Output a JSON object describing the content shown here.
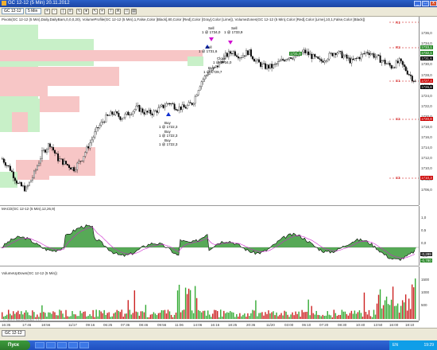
{
  "window": {
    "title": "GC 12-12 (5 Min)  20.11.2012",
    "minimize_label": "_",
    "maximize_label": "□",
    "close_label": "x"
  },
  "toolbar": {
    "instrument": "GC 12-12",
    "timeframe": "5 Min"
  },
  "price_pane": {
    "indicator_text": "Pivots(GC 12-12 (5 Min),Daily,DailyBars,0,0,0,20), VolumeProfile(GC 12-12 (5 Min),1,False,Color [Black],80,Color [Red],Color [Gray],Color [Lime]), VolumeZones(GC 12-12 (5 Min),Color [Red],Color [Lime],10,1,False,Color [Black])",
    "price_ticks": [
      "1736,0",
      "1734,0",
      "1732,0",
      "1730,0",
      "1728,0",
      "1726,0",
      "1724,0",
      "1722,0",
      "1720,0",
      "1718,0",
      "1716,0",
      "1714,0",
      "1712,0",
      "1710,0",
      "1708,0",
      "1706,0"
    ],
    "pivot_tags": [
      {
        "name": "R1",
        "value": ""
      },
      {
        "name": "R2",
        "value": "1733,1"
      },
      {
        "name": "S1",
        "value": "1727,4"
      },
      {
        "name": "S2",
        "value": "1720,8"
      },
      {
        "name": "S3",
        "value": "1710,3"
      }
    ],
    "current_price": "1731,6",
    "price_tags": [
      "1732,1",
      "1726,8"
    ],
    "mid_tag": "1731,8",
    "annotations": [
      {
        "text": "Sell"
      },
      {
        "text": "1 @ 1734,0"
      },
      {
        "text": "Sell"
      },
      {
        "text": "1 @ 1733,9"
      },
      {
        "text": "Sell"
      },
      {
        "text": "1 @ 1731,6"
      },
      {
        "text": "Close"
      },
      {
        "text": "1 @ 1734,0"
      },
      {
        "text": "Buy"
      },
      {
        "text": "1 @ 1729,7"
      },
      {
        "text": "Buy"
      },
      {
        "text": "1 @ 1722,3"
      },
      {
        "text": "Buy"
      },
      {
        "text": "1 @ 1722,3"
      },
      {
        "text": "Buy"
      },
      {
        "text": "1 @ 1722,3"
      }
    ]
  },
  "macd_pane": {
    "label": "MACD(GC 12-12 (5 Min),12,26,9)",
    "ticks": [
      "1,0",
      "0,5",
      "0,0",
      "-0,5"
    ],
    "tags": [
      "-0,289",
      "-0,780"
    ]
  },
  "volume_pane": {
    "label": "VolumeUpDown(GC 12-12 (5 Min))",
    "ticks": [
      "1500",
      "1000",
      "500"
    ]
  },
  "time_axis": [
    "16:35",
    "17:46",
    "18:56",
    "11/17",
    "09:16",
    "06:25",
    "07:36",
    "08:46",
    "09:56",
    "11:06",
    "14:06",
    "16:16",
    "18:25",
    "20:36",
    "11/20",
    "03:00",
    "06:10",
    "07:20",
    "08:30",
    "10:40",
    "13:50",
    "16:00",
    "18:10"
  ],
  "copyright": "© 2012 NinjaTrader, LLC",
  "tabs": [
    "GC 12-12"
  ],
  "taskbar": {
    "start_label": "Пуск",
    "language": "EN",
    "clock": "19:29"
  },
  "colors": {
    "up_bar": "#33aa33",
    "down_bar": "#cc2222",
    "macd_fill": "#3a9a3a",
    "signal_line": "#cc22cc",
    "zone_green": "#c8f0c8",
    "zone_red": "#f7c6c6",
    "pivot_red": "#cc0000"
  },
  "chart_data": {
    "type": "candlestick",
    "ylim": [
      1705,
      1738
    ],
    "close_path": [
      1713,
      1711,
      1708,
      1707,
      1710,
      1714,
      1716,
      1713,
      1712,
      1711,
      1713,
      1716,
      1719,
      1721,
      1722,
      1721,
      1722,
      1723,
      1722,
      1722,
      1723,
      1724,
      1723,
      1723,
      1724,
      1728,
      1730,
      1731,
      1733,
      1734,
      1733,
      1734,
      1732,
      1731,
      1731,
      1732,
      1733,
      1733,
      1734,
      1733,
      1732,
      1733,
      1734,
      1733,
      1732,
      1733,
      1734,
      1733,
      1732,
      1731,
      1732,
      1730,
      1728
    ]
  }
}
